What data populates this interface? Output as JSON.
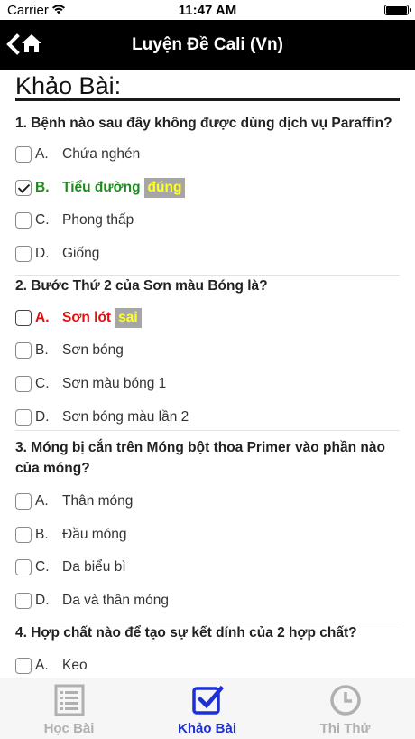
{
  "status": {
    "carrier": "Carrier",
    "time": "11:47 AM"
  },
  "nav": {
    "title": "Luyện Đề Cali (Vn)",
    "back_icon": "chevron-left-icon",
    "home_icon": "home-icon"
  },
  "page": {
    "title": "Khảo Bài:"
  },
  "questions": [
    {
      "text": "1. Bệnh nào sau đây không được dùng dịch vụ Paraffin?",
      "options": [
        {
          "letter": "A.",
          "text": "Chứa nghén"
        },
        {
          "letter": "B.",
          "text": "Tiểu đường",
          "checked": true,
          "result": "correct",
          "tag": "đúng"
        },
        {
          "letter": "C.",
          "text": "Phong thấp"
        },
        {
          "letter": "D.",
          "text": "Giống"
        }
      ]
    },
    {
      "text": "2. Bước Thứ 2 của Sơn màu Bóng là?",
      "options": [
        {
          "letter": "A.",
          "text": "Sơn lót",
          "result": "wrong",
          "tag": "sai"
        },
        {
          "letter": "B.",
          "text": "Sơn bóng"
        },
        {
          "letter": "C.",
          "text": "Sơn màu bóng 1"
        },
        {
          "letter": "D.",
          "text": "Sơn bóng màu lần 2"
        }
      ]
    },
    {
      "text": "3. Móng bị cắn trên Móng bột thoa Primer vào phần nào của móng?",
      "options": [
        {
          "letter": "A.",
          "text": "Thân móng"
        },
        {
          "letter": "B.",
          "text": "Đầu móng"
        },
        {
          "letter": "C.",
          "text": "Da biểu bì"
        },
        {
          "letter": "D.",
          "text": "Da và thân móng"
        }
      ]
    },
    {
      "text": "4. Hợp chất nào để tạo sự kết dính của 2 hợp chất?",
      "options": [
        {
          "letter": "A.",
          "text": "Keo"
        }
      ]
    }
  ],
  "tabs": [
    {
      "label": "Học Bài",
      "icon": "list-icon",
      "active": false
    },
    {
      "label": "Khảo Bài",
      "icon": "checkbox-icon",
      "active": true
    },
    {
      "label": "Thi Thử",
      "icon": "clock-icon",
      "active": false
    }
  ],
  "colors": {
    "correct": "#1f8a1f",
    "wrong": "#e01010",
    "tag_text": "#ffff2a",
    "tag_bg": "#a6a6a6",
    "active_tab": "#1d2fd6",
    "inactive_tab": "#b0b0b0"
  }
}
